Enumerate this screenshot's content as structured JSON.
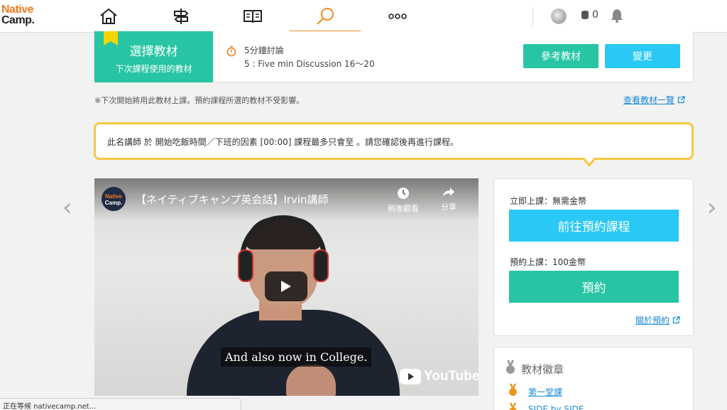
{
  "header": {
    "logo_line1": "Native",
    "logo_line2": "Camp.",
    "nav": [
      "home-icon",
      "signpost-icon",
      "book-icon",
      "search-icon",
      "more-icon"
    ],
    "active_nav": "search-icon",
    "coin_count": "0"
  },
  "material": {
    "title": "選擇教材",
    "subtitle": "下次課程使用的教材",
    "duration": "5分鐘討論",
    "name": "5 : Five min Discussion 16～20",
    "reference_button": "參考教材",
    "change_button": "變更"
  },
  "notice": {
    "text": "※下次開始將用此教材上課。預約課程所選的教材不受影響。",
    "list_link": "查看教材一覽"
  },
  "alert": {
    "text": "此名講師 於 開始吃飯時間／下班的因素 [00:00] 課程最多只會至 。請您確認後再進行課程。"
  },
  "video": {
    "channel_line1": "Native",
    "channel_line2": "Camp.",
    "title": "【ネイティブキャンプ英会話】Irvin講師",
    "watch_later": "稍後觀看",
    "share": "分享",
    "subtitle": "And also now in College.",
    "brand": "YouTube"
  },
  "booking": {
    "instant_label": "立即上課：無需金幣",
    "instant_button": "前往預約課程",
    "reserve_label": "預約上課：100金幣",
    "reserve_button": "預約",
    "about_link": "關於預約"
  },
  "badges": {
    "title": "教材徽章",
    "items": [
      "第一堂課",
      "SIDE by SIDE"
    ]
  },
  "status_bar": "正在等候 nativecamp.net...",
  "colors": {
    "green": "#27c5a3",
    "blue": "#29c8f5",
    "orange": "#f08a24",
    "alert_border": "#f5c842",
    "link": "#1b8bd8"
  }
}
